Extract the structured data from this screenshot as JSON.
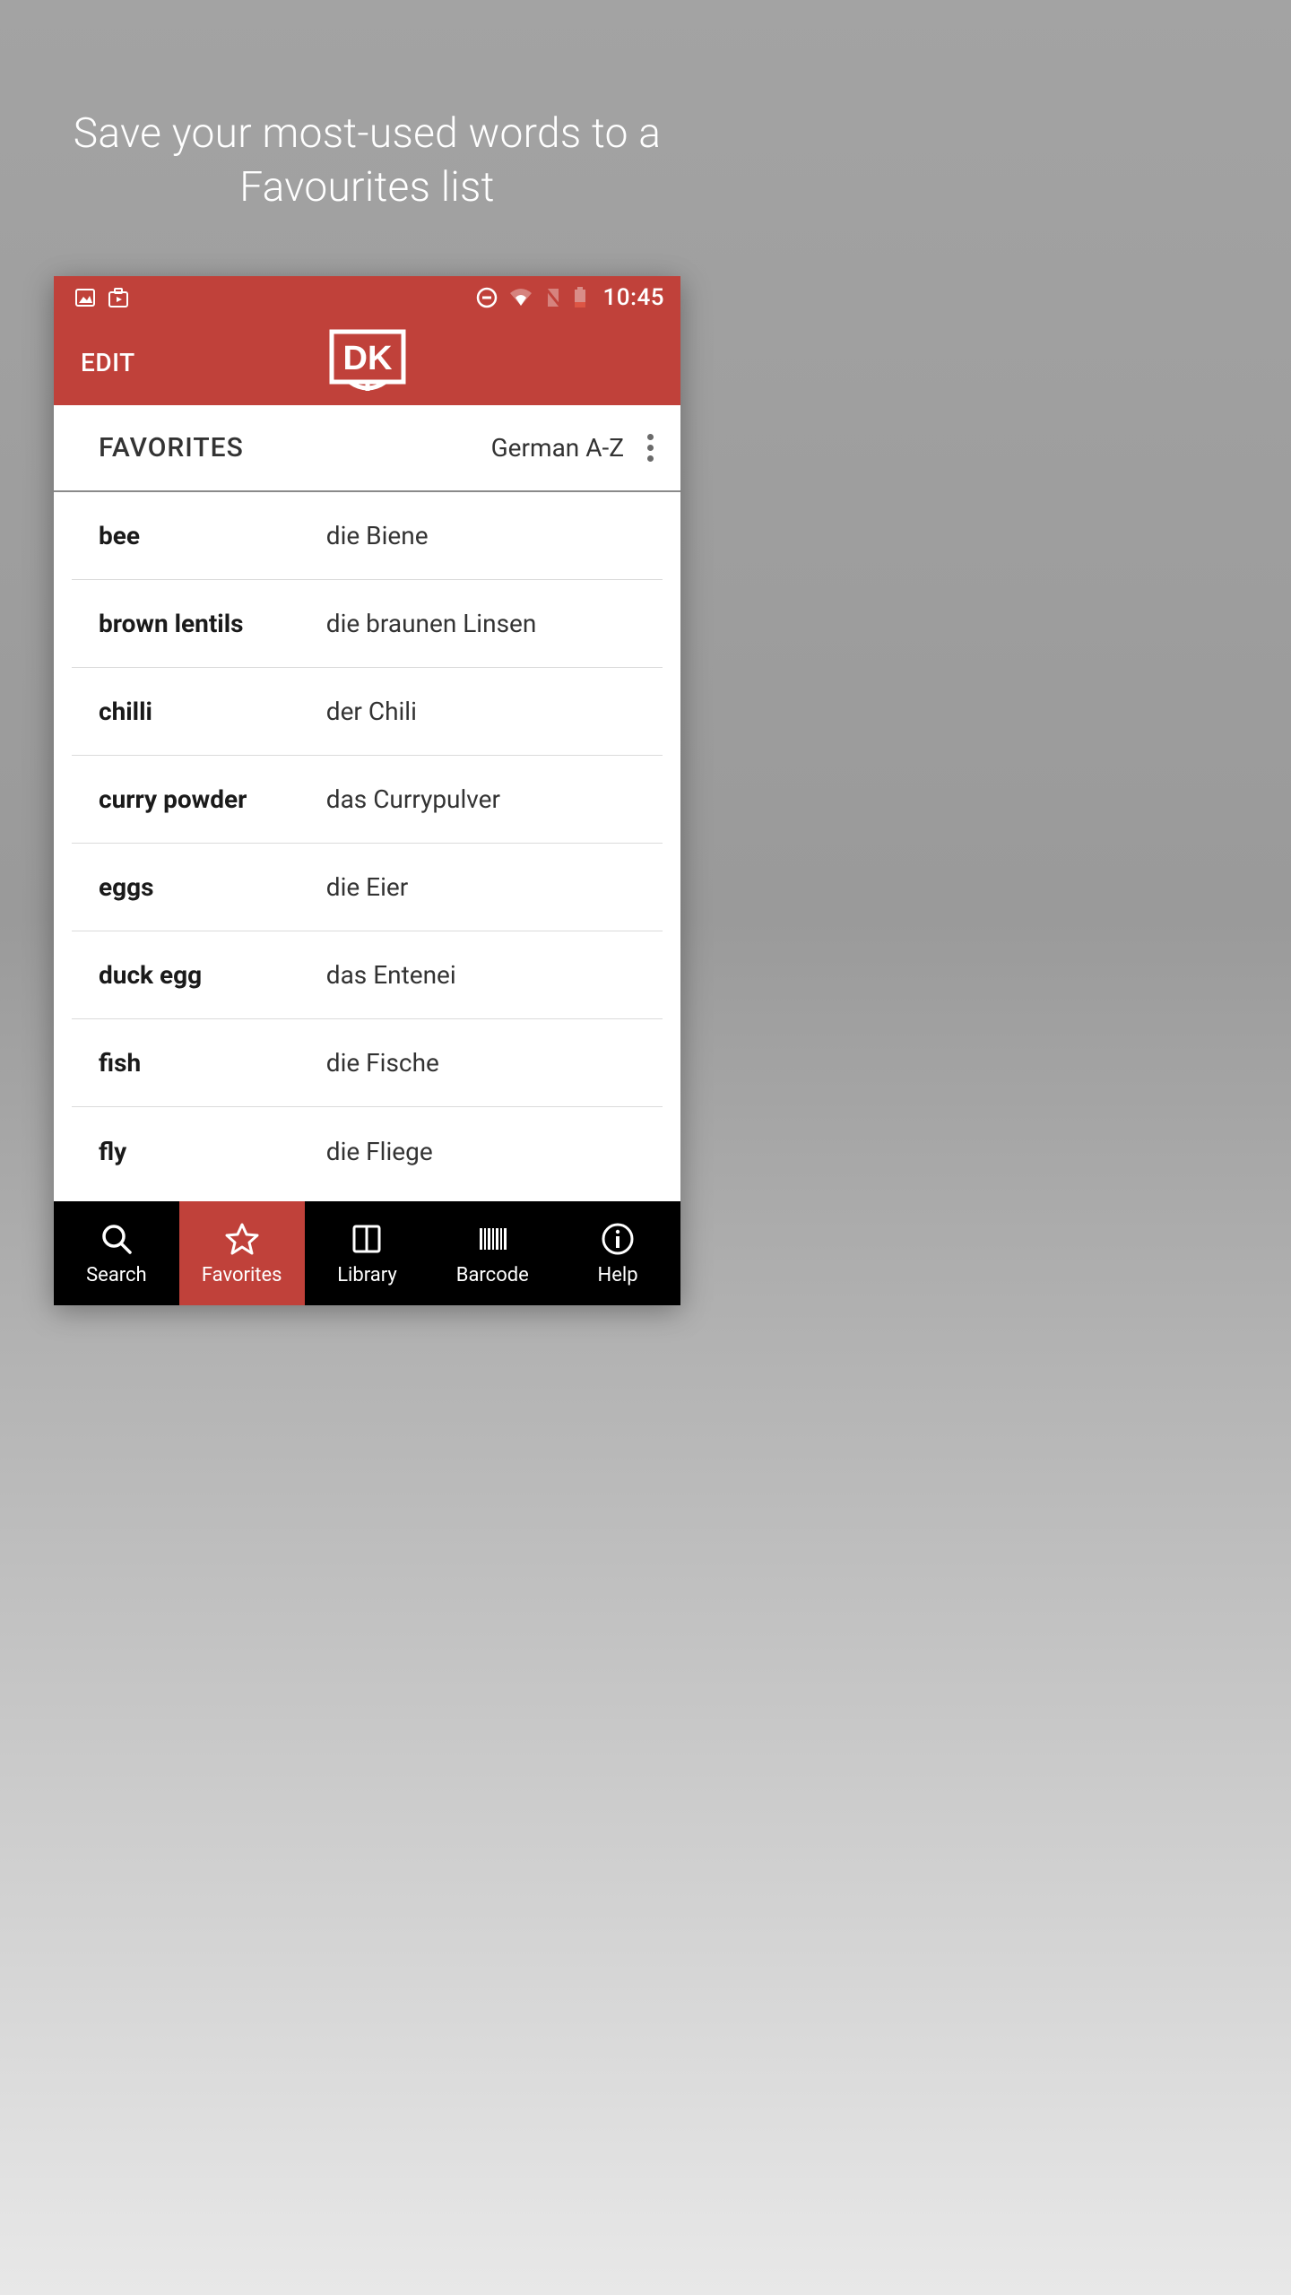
{
  "promo": {
    "headline": "Save your most-used words to a Favourites list"
  },
  "status_bar": {
    "time": "10:45"
  },
  "app_bar": {
    "edit_label": "EDIT",
    "logo_text": "DK"
  },
  "favorites": {
    "title": "FAVORITES",
    "sort_label": "German A-Z",
    "entries": [
      {
        "en": "bee",
        "de": "die Biene"
      },
      {
        "en": "brown lentils",
        "de": "die braunen Linsen"
      },
      {
        "en": "chilli",
        "de": "der Chili"
      },
      {
        "en": "curry powder",
        "de": "das Currypulver"
      },
      {
        "en": "eggs",
        "de": "die Eier"
      },
      {
        "en": "duck egg",
        "de": "das Entenei"
      },
      {
        "en": "fish",
        "de": "die Fische"
      },
      {
        "en": "fly",
        "de": "die Fliege"
      }
    ]
  },
  "tabs": {
    "items": [
      {
        "id": "search",
        "label": "Search"
      },
      {
        "id": "favorites",
        "label": "Favorites"
      },
      {
        "id": "library",
        "label": "Library"
      },
      {
        "id": "barcode",
        "label": "Barcode"
      },
      {
        "id": "help",
        "label": "Help"
      }
    ],
    "active": "favorites"
  }
}
